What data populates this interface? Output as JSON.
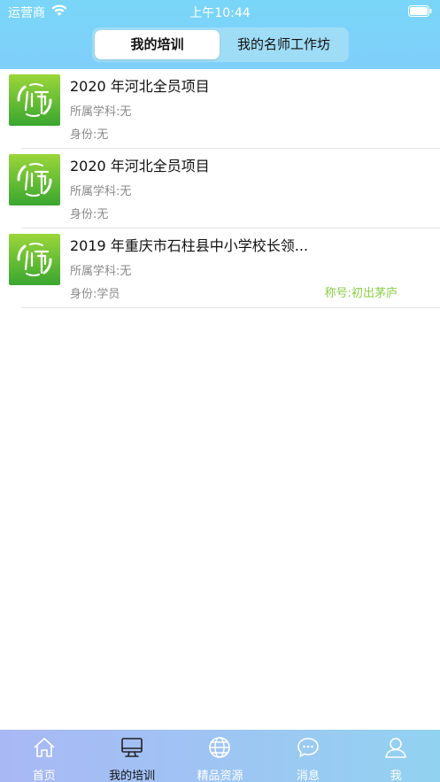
{
  "status_bar": {
    "carrier": "运营商",
    "time": "上午10:44"
  },
  "segmented": {
    "tab_training": "我的培训",
    "tab_workshop": "我的名师工作坊"
  },
  "items": [
    {
      "title": "2020 年河北全员项目",
      "subject": "所属学科:无",
      "role": "身份:无",
      "rank": ""
    },
    {
      "title": "2020 年河北全员项目",
      "subject": "所属学科:无",
      "role": "身份:无",
      "rank": ""
    },
    {
      "title": "2019 年重庆市石柱县中小学校长领...",
      "subject": "所属学科:无",
      "role": "身份:学员",
      "rank": "称号:初出茅庐"
    }
  ],
  "tabbar": {
    "home": "首页",
    "training": "我的培训",
    "resources": "精品资源",
    "messages": "消息",
    "me": "我"
  },
  "colors": {
    "header": "#7fd3f9",
    "rank_green": "#8ccf45",
    "logo_green": "#5bbd33"
  }
}
